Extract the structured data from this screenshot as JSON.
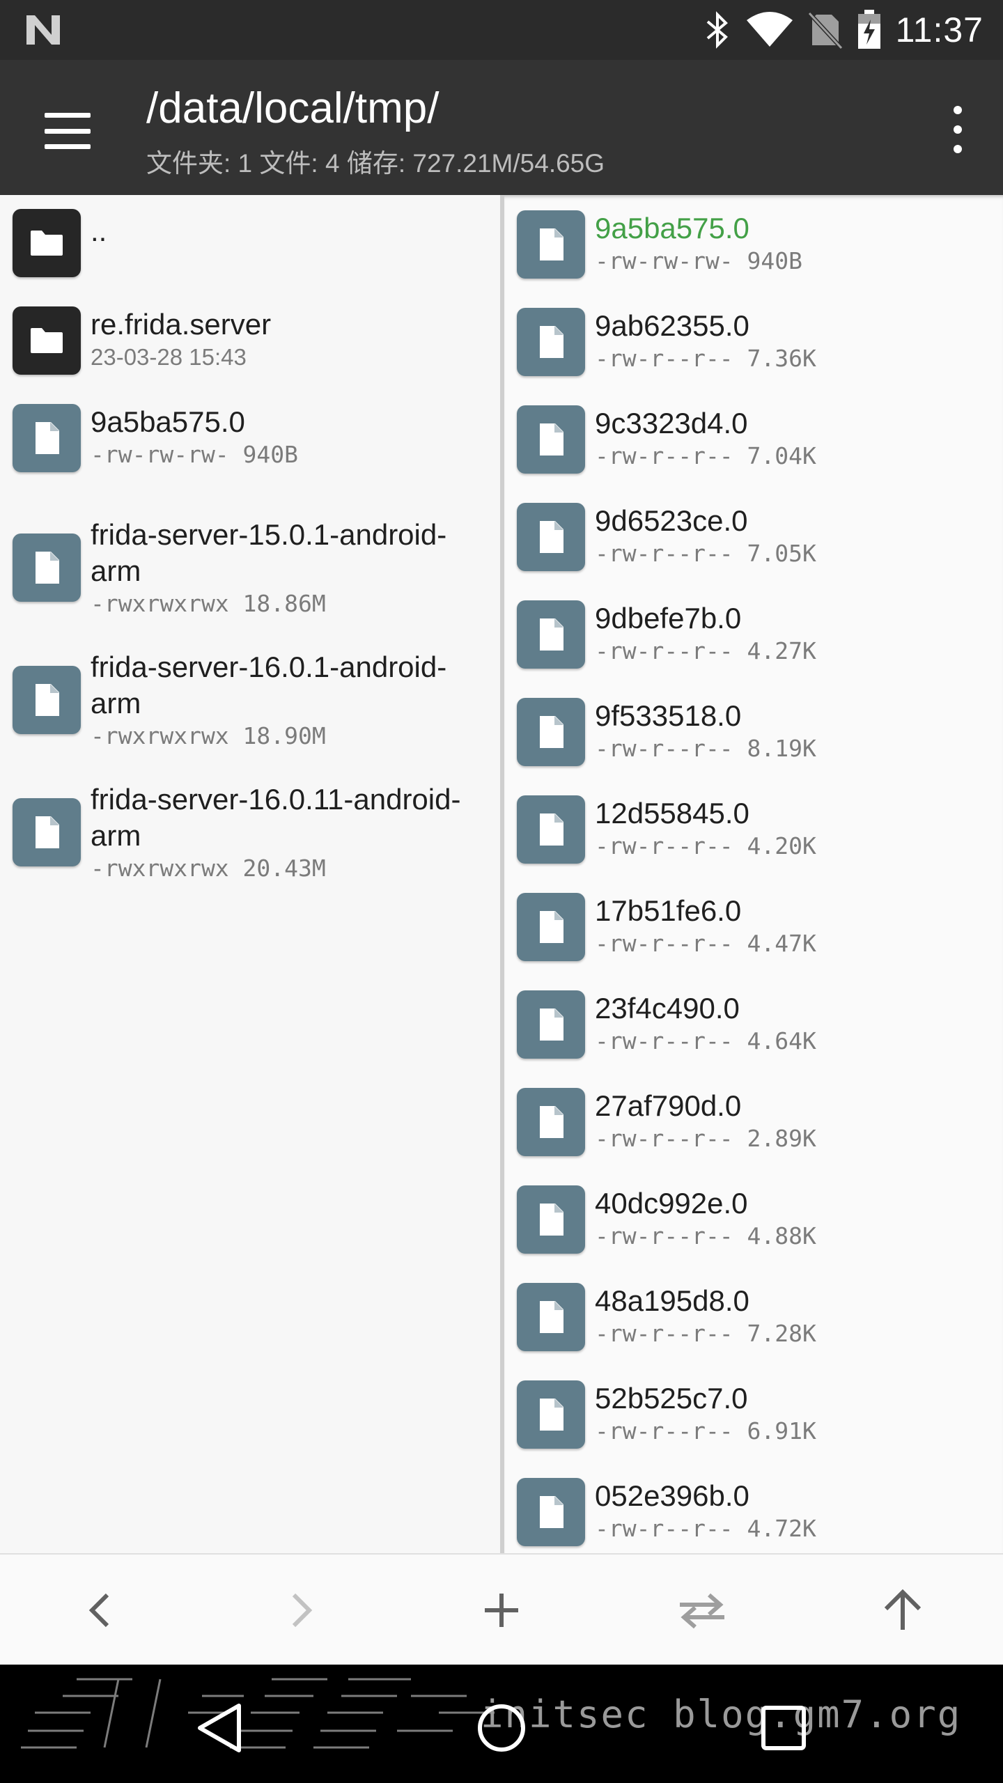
{
  "status_bar": {
    "time": "11:37",
    "icons": [
      "n-logo-icon",
      "bluetooth-icon",
      "wifi-icon",
      "no-sim-icon",
      "battery-charging-icon"
    ]
  },
  "app_bar": {
    "title": "/data/local/tmp/",
    "subtitle": "文件夹: 1  文件: 4  储存: 727.21M/54.65G"
  },
  "left_pane": {
    "items": [
      {
        "type": "folder",
        "name": "..",
        "meta": ""
      },
      {
        "type": "folder",
        "name": "re.frida.server",
        "meta": "23-03-28 15:43"
      },
      {
        "type": "file",
        "name": "9a5ba575.0",
        "meta": "-rw-rw-rw- 940B"
      },
      {
        "type": "file",
        "name": "frida-server-15.0.1-android-\narm",
        "meta": "-rwxrwxrwx 18.86M"
      },
      {
        "type": "file",
        "name": "frida-server-16.0.1-android-\narm",
        "meta": "-rwxrwxrwx 18.90M"
      },
      {
        "type": "file",
        "name": "frida-server-16.0.11-android-\narm",
        "meta": "-rwxrwxrwx 20.43M"
      }
    ]
  },
  "right_pane": {
    "items": [
      {
        "name": "9a5ba575.0",
        "meta": "-rw-rw-rw- 940B",
        "highlight": true
      },
      {
        "name": "9ab62355.0",
        "meta": "-rw-r--r-- 7.36K"
      },
      {
        "name": "9c3323d4.0",
        "meta": "-rw-r--r-- 7.04K"
      },
      {
        "name": "9d6523ce.0",
        "meta": "-rw-r--r-- 7.05K"
      },
      {
        "name": "9dbefe7b.0",
        "meta": "-rw-r--r-- 4.27K"
      },
      {
        "name": "9f533518.0",
        "meta": "-rw-r--r-- 8.19K"
      },
      {
        "name": "12d55845.0",
        "meta": "-rw-r--r-- 4.20K"
      },
      {
        "name": "17b51fe6.0",
        "meta": "-rw-r--r-- 4.47K"
      },
      {
        "name": "23f4c490.0",
        "meta": "-rw-r--r-- 4.64K"
      },
      {
        "name": "27af790d.0",
        "meta": "-rw-r--r-- 2.89K"
      },
      {
        "name": "40dc992e.0",
        "meta": "-rw-r--r-- 4.88K"
      },
      {
        "name": "48a195d8.0",
        "meta": "-rw-r--r-- 7.28K"
      },
      {
        "name": "52b525c7.0",
        "meta": "-rw-r--r-- 6.91K"
      },
      {
        "name": "052e396b.0",
        "meta": "-rw-r--r-- 4.72K"
      }
    ]
  },
  "toolbar": {
    "buttons": [
      "back-icon",
      "forward-icon",
      "add-icon",
      "swap-icon",
      "up-icon"
    ]
  },
  "watermark": {
    "text": "initsec blog.gm7.org"
  },
  "colors": {
    "appbar": "#333333",
    "statusbar": "#2b2b2b",
    "file_icon_bg": "#607d8b",
    "folder_icon_bg": "#262626",
    "highlight": "#43a047"
  }
}
